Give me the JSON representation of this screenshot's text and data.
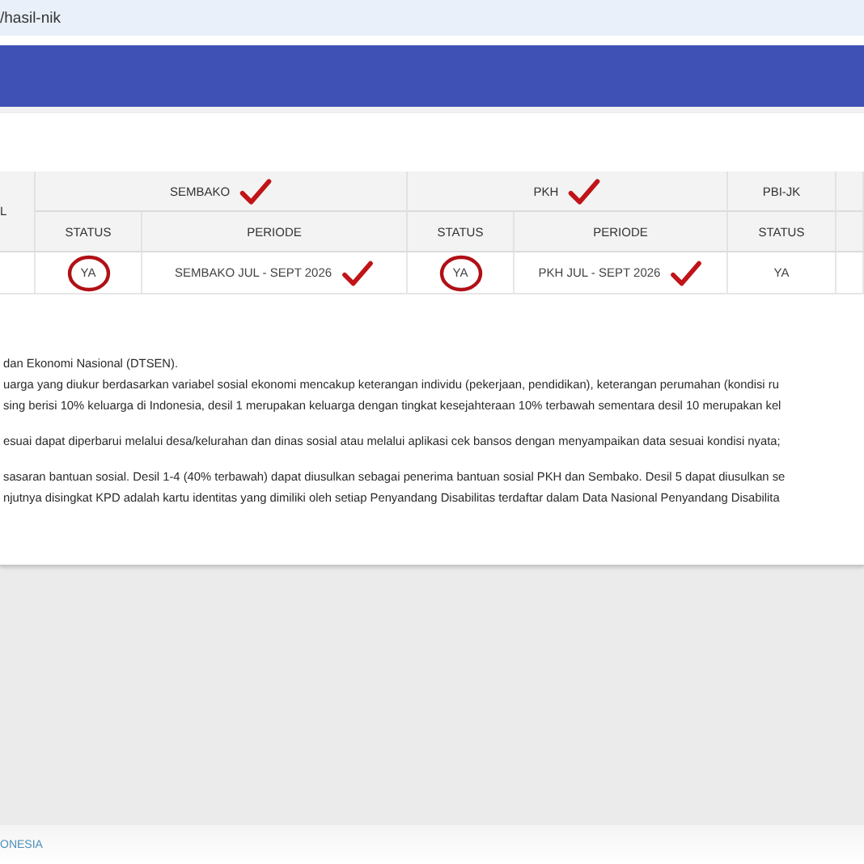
{
  "address_bar": {
    "url": "/hasil-nik"
  },
  "table": {
    "corner_header": "L",
    "groups": [
      {
        "label": "SEMBAKO",
        "ticked": true
      },
      {
        "label": "PKH",
        "ticked": true
      },
      {
        "label": "PBI-JK",
        "ticked": false
      }
    ],
    "columns": [
      {
        "label": "STATUS"
      },
      {
        "label": "PERIODE"
      },
      {
        "label": "STATUS"
      },
      {
        "label": "PERIODE"
      },
      {
        "label": "STATUS"
      }
    ],
    "rows": [
      {
        "cells": [
          {
            "text": "YA",
            "circled": true,
            "ticked": false
          },
          {
            "text": "SEMBAKO JUL - SEPT 2026",
            "circled": false,
            "ticked": true
          },
          {
            "text": "YA",
            "circled": true,
            "ticked": false
          },
          {
            "text": "PKH JUL - SEPT 2026",
            "circled": false,
            "ticked": true
          },
          {
            "text": "YA",
            "circled": false,
            "ticked": false
          }
        ]
      }
    ]
  },
  "notes": [
    [
      "dan Ekonomi Nasional (DTSEN).",
      "uarga yang diukur berdasarkan variabel sosial ekonomi mencakup keterangan individu (pekerjaan, pendidikan), keterangan perumahan (kondisi ru",
      "sing berisi 10% keluarga di Indonesia, desil 1 merupakan keluarga dengan tingkat kesejahteraan 10% terbawah sementara desil 10 merupakan kel"
    ],
    [
      "esuai dapat diperbarui melalui desa/kelurahan dan dinas sosial atau melalui aplikasi cek bansos dengan menyampaikan data sesuai kondisi nyata;"
    ],
    [
      "sasaran bantuan sosial. Desil 1-4 (40% terbawah) dapat diusulkan sebagai penerima bantuan sosial PKH dan Sembako. Desil 5 dapat diusulkan se",
      "njutnya disingkat KPD adalah kartu identitas yang dimiliki oleh setiap Penyandang Disabilitas terdaftar dalam Data Nasional Penyandang Disabilita"
    ]
  ],
  "footer": {
    "text": "ONESIA"
  }
}
